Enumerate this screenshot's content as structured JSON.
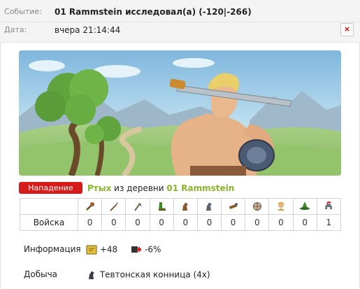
{
  "header": {
    "subject_label": "Событие:",
    "subject": "01 Rammstein исследовал(а) (-120|-266)",
    "date_label": "Дата:",
    "date": "вчера 21:14:44",
    "delete_symbol": "×"
  },
  "colors": {
    "attack": "#d61b1b",
    "player": "#88b52a",
    "delete": "#d00000"
  },
  "attack": {
    "badge": "Нападение",
    "player": "Ртых",
    "from_text": "из деревни",
    "village": "01 Rammstein"
  },
  "troops": {
    "row_label": "Войска",
    "units": [
      {
        "icon": "club-icon",
        "count": "0"
      },
      {
        "icon": "spear-icon",
        "count": "0"
      },
      {
        "icon": "axe-icon",
        "count": "0"
      },
      {
        "icon": "boot-icon",
        "count": "0"
      },
      {
        "icon": "horse-icon",
        "count": "0"
      },
      {
        "icon": "knight-horse-icon",
        "count": "0"
      },
      {
        "icon": "ram-icon",
        "count": "0"
      },
      {
        "icon": "catapult-icon",
        "count": "0"
      },
      {
        "icon": "chief-icon",
        "count": "0"
      },
      {
        "icon": "settler-hat-icon",
        "count": "0"
      },
      {
        "icon": "hero-helmet-icon",
        "count": "1"
      }
    ]
  },
  "info": {
    "label": "Информация",
    "exp_icon": "experience-icon",
    "exp_value": "+48",
    "health_icon": "health-icon",
    "health_value": "-6%"
  },
  "loot": {
    "label": "Добыча",
    "icon": "teutonic-cavalry-icon",
    "value": "Тевтонская конница (4x)"
  }
}
